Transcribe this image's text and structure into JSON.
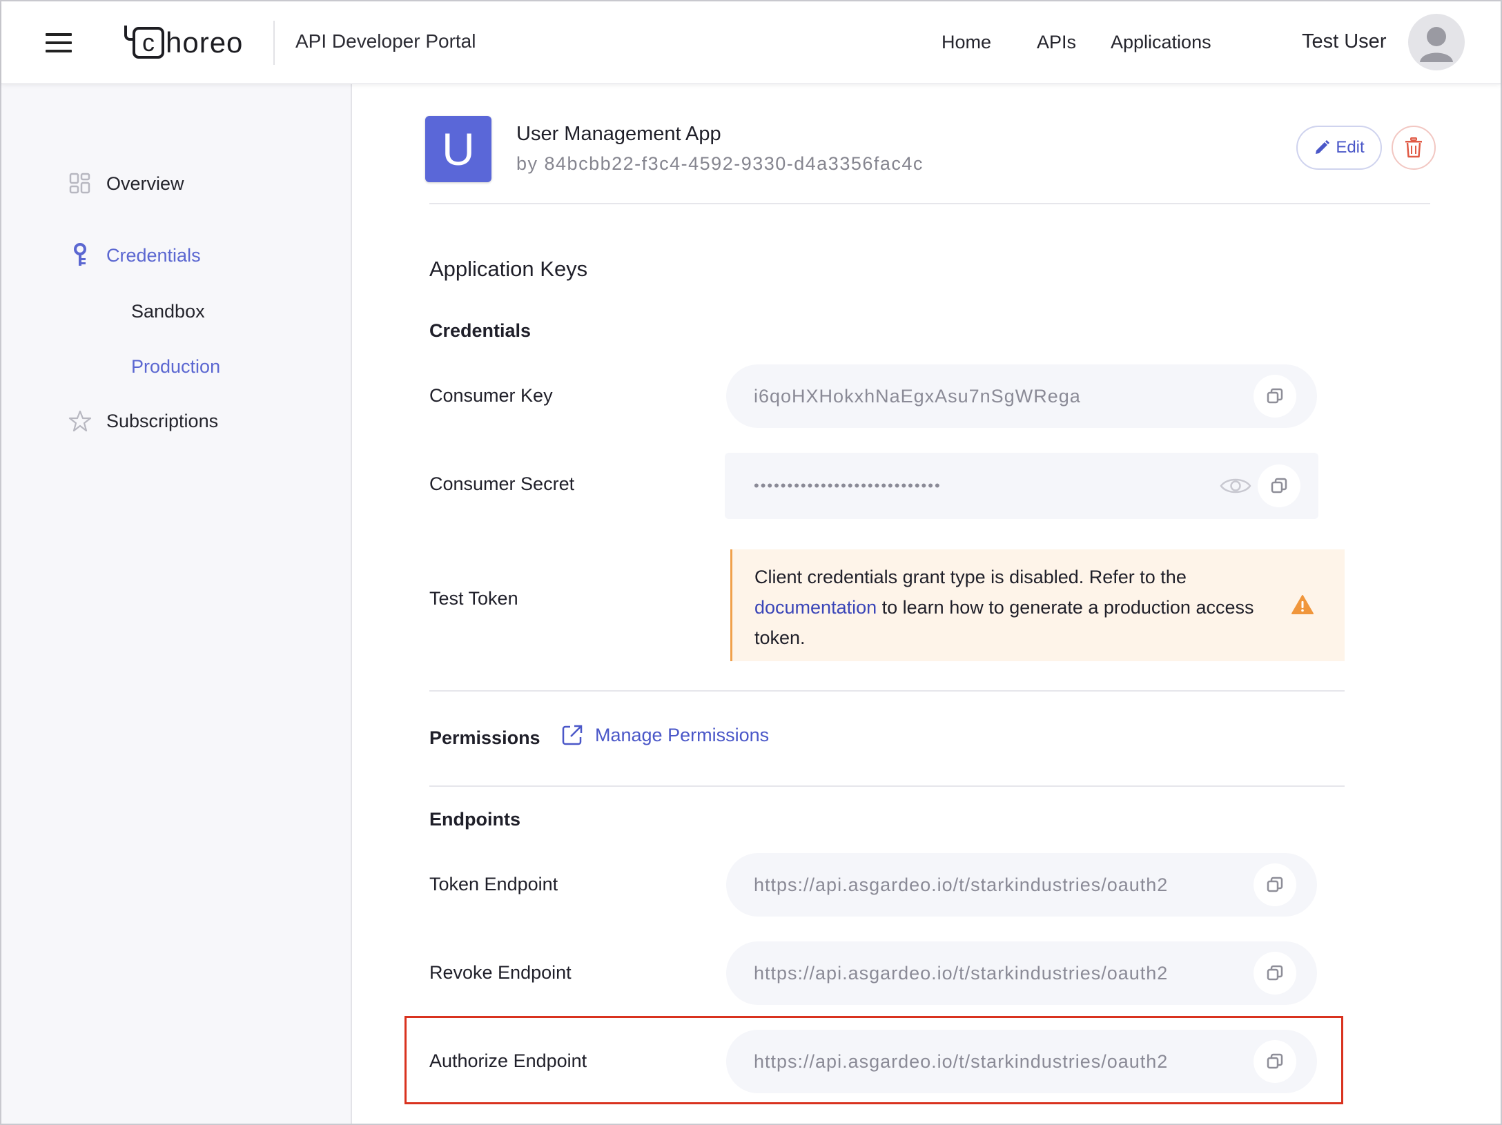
{
  "header": {
    "logo_text": "horeo",
    "logo_mark": "c",
    "portal_title": "API Developer Portal",
    "nav": [
      "Home",
      "APIs",
      "Applications"
    ],
    "user_name": "Test User"
  },
  "sidebar": {
    "items": [
      {
        "label": "Overview",
        "icon": "grid-icon"
      },
      {
        "label": "Credentials",
        "icon": "key-icon",
        "active": true
      },
      {
        "label": "Sandbox"
      },
      {
        "label": "Production",
        "active": true
      },
      {
        "label": "Subscriptions",
        "icon": "star-icon"
      }
    ]
  },
  "app": {
    "avatar_letter": "U",
    "name": "User Management App",
    "owner": "by 84bcbb22-f3c4-4592-9330-d4a3356fac4c",
    "edit_label": "Edit"
  },
  "keys": {
    "section_title": "Application Keys",
    "credentials_title": "Credentials",
    "consumer_key_label": "Consumer Key",
    "consumer_key_value": "i6qoHXHokxhNaEgxAsu7nSgWRega",
    "consumer_secret_label": "Consumer Secret",
    "consumer_secret_value": "••••••••••••••••••••••••••••",
    "test_token_label": "Test Token",
    "alert": {
      "text_before": "Client credentials grant type is disabled. Refer to the",
      "link": "documentation",
      "text_after": "to learn how to generate a production access token."
    }
  },
  "permissions": {
    "label": "Permissions",
    "link": "Manage Permissions"
  },
  "endpoints": {
    "title": "Endpoints",
    "token_label": "Token Endpoint",
    "token_value": "https://api.asgardeo.io/t/starkindustries/oauth2",
    "revoke_label": "Revoke Endpoint",
    "revoke_value": "https://api.asgardeo.io/t/starkindustries/oauth2",
    "authorize_label": "Authorize Endpoint",
    "authorize_value": "https://api.asgardeo.io/t/starkindustries/oauth2"
  },
  "colors": {
    "accent": "#5b67d1",
    "app_avatar": "#5a67d8",
    "alert_bg": "#fef4e9",
    "alert_border": "#f0a04b",
    "highlight": "#d9321f",
    "delete": "#e05a45"
  }
}
